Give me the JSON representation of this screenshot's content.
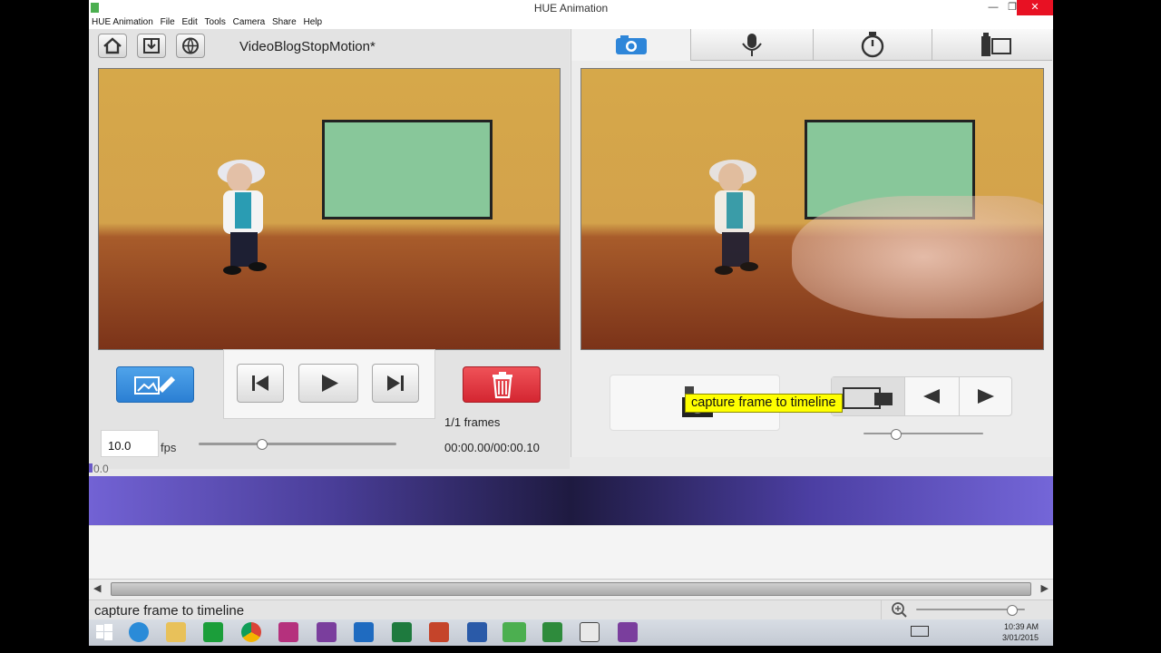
{
  "window": {
    "title": "HUE Animation"
  },
  "menu": [
    "HUE Animation",
    "File",
    "Edit",
    "Tools",
    "Camera",
    "Share",
    "Help"
  ],
  "left": {
    "project_title": "VideoBlogStopMotion*",
    "frames_label": "1/1 frames",
    "fps_value": "10.0",
    "fps_unit": "fps",
    "time_readout": "00:00.00/00:00.10"
  },
  "right": {
    "tabs": [
      "camera-icon",
      "microphone-icon",
      "stopwatch-icon",
      "film-strip-icon"
    ],
    "tooltip": "capture frame to timeline"
  },
  "timeline": {
    "start_label": "0.0"
  },
  "status": {
    "text": "capture frame to timeline"
  },
  "taskbar": {
    "time": "10:39 AM",
    "date": "3/01/2015",
    "apps": [
      "start-icon",
      "internet-explorer-icon",
      "file-explorer-icon",
      "store-icon",
      "chrome-icon",
      "camera-app-icon",
      "onenote-icon",
      "outlook-icon",
      "excel-icon",
      "powerpoint-icon",
      "word-icon",
      "hue-icon",
      "camtasia-icon",
      "camtasia-recorder-icon",
      "onenote-2-icon"
    ]
  },
  "colors": {
    "accent_blue": "#2e86d9",
    "delete_red": "#e0313c",
    "timeline_purple": "#7262d4",
    "tooltip_yellow": "#ffff00"
  }
}
